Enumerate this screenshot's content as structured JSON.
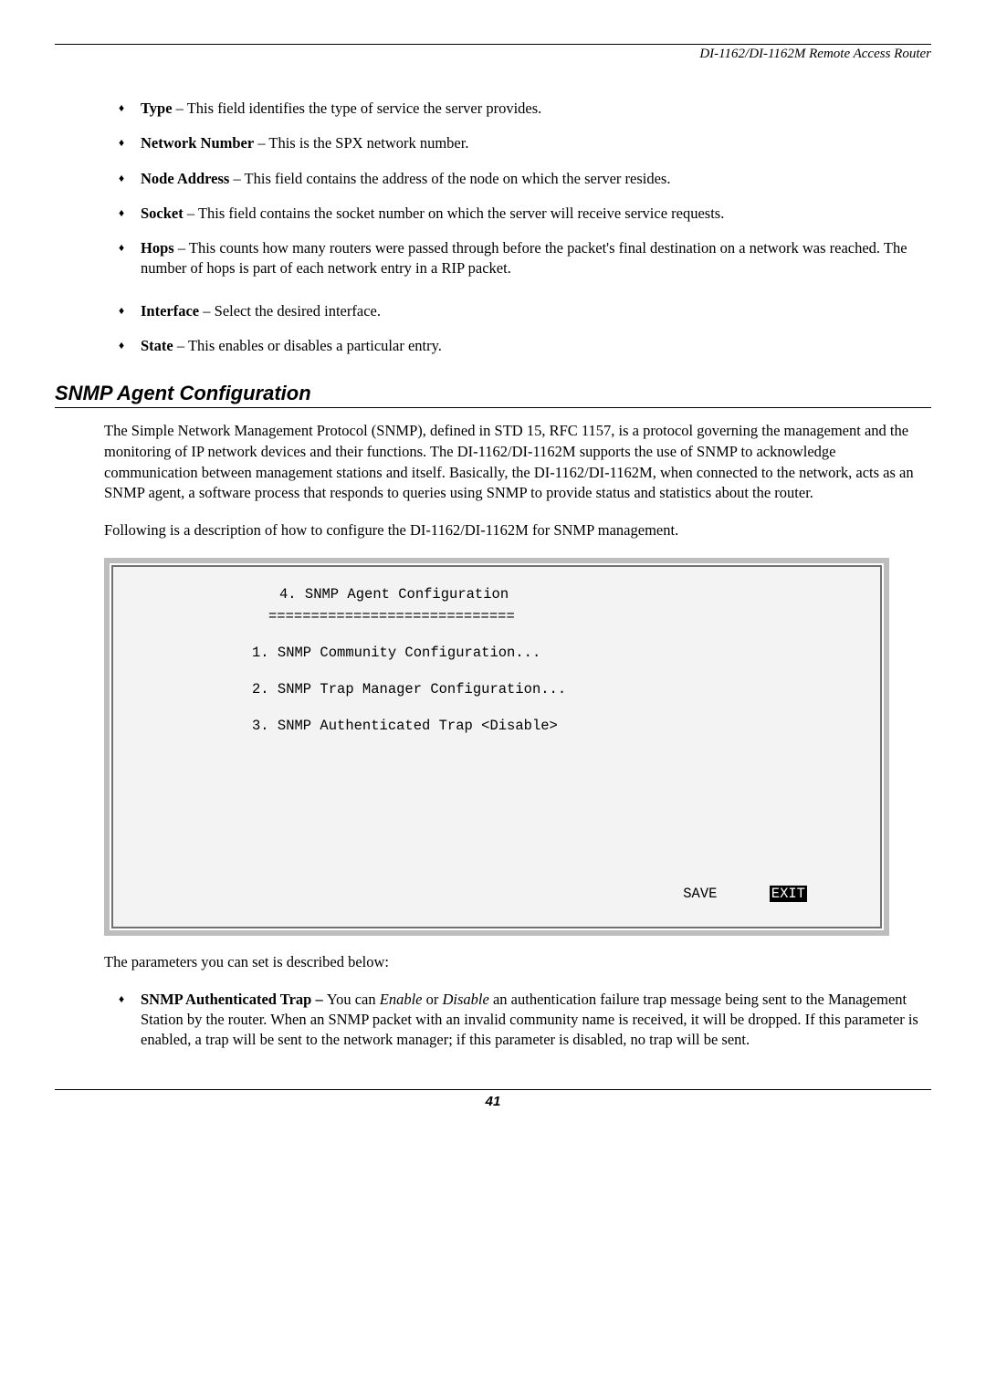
{
  "header": {
    "doc_title": "DI-1162/DI-1162M Remote Access Router"
  },
  "bullets_top": [
    {
      "term": "Type",
      "desc": " – This field identifies the type of service the server provides."
    },
    {
      "term": "Network Number",
      "desc": " – This is the SPX network number."
    },
    {
      "term": "Node Address",
      "desc": " – This field contains the address of the node on which the server resides."
    },
    {
      "term": "Socket",
      "desc": " – This field contains the socket number on which the server will receive service requests."
    },
    {
      "term": "Hops",
      "desc": " – This counts how many routers were passed through before the packet's final destination on a network was reached. The number of hops is part of each network entry in a RIP packet."
    },
    {
      "term": "Interface",
      "desc": " – Select the desired interface."
    },
    {
      "term": "State",
      "desc": " – This enables or disables a particular entry."
    }
  ],
  "section": {
    "title": "SNMP Agent Configuration",
    "para1": "The Simple Network Management Protocol (SNMP), defined in STD 15, RFC 1157, is a protocol governing the management and the monitoring of IP network devices and their functions.  The DI-1162/DI-1162M supports the use of SNMP to acknowledge communication between management stations and itself.  Basically, the DI-1162/DI-1162M, when connected to the network, acts as an SNMP agent, a software process that responds to queries using SNMP to provide status and statistics about the router.",
    "para2": "Following is a description of how to configure the DI-1162/DI-1162M for SNMP management."
  },
  "terminal": {
    "title": "4. SNMP Agent Configuration",
    "underline": "=============================",
    "items": [
      "1. SNMP Community Configuration...",
      "2. SNMP Trap Manager Configuration...",
      "3. SNMP Authenticated Trap <Disable>"
    ],
    "save": "SAVE",
    "exit": "EXIT"
  },
  "after_terminal": {
    "intro": "The parameters you can set is described below:",
    "bullet_term": "SNMP Authenticated Trap – ",
    "bullet_pre": "You can ",
    "enable": "Enable",
    "or": " or ",
    "disable": "Disable",
    "bullet_post": " an authentication failure trap message being sent to the Management Station by the router. When an SNMP packet with an invalid community name is received, it will be dropped. If this parameter is enabled, a trap will be sent to the network manager; if this parameter is disabled, no trap will be sent."
  },
  "footer": {
    "page": "41"
  }
}
